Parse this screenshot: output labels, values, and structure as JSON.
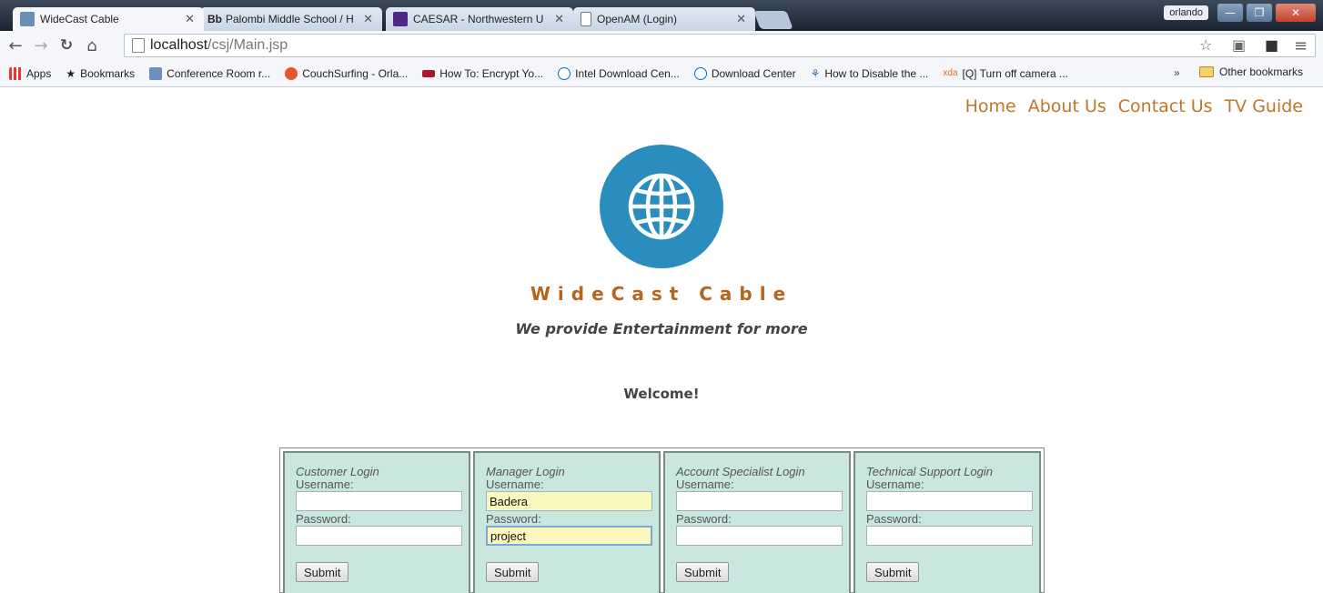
{
  "browser": {
    "tabs": [
      {
        "title": "WideCast Cable",
        "active": true
      },
      {
        "title": "Palombi Middle School / H",
        "prefix": "Bb"
      },
      {
        "title": "CAESAR - Northwestern U"
      },
      {
        "title": "OpenAM (Login)"
      }
    ],
    "user": "orlando",
    "url_host": "localhost",
    "url_path": "/csj/Main.jsp",
    "bookmarks": [
      "Apps",
      "Bookmarks",
      "Conference Room r...",
      "CouchSurfing - Orla...",
      "How To: Encrypt Yo...",
      "Intel Download Cen...",
      "Download Center",
      "How to Disable the ...",
      "[Q] Turn off camera ..."
    ],
    "more": "»",
    "other_bookmarks": "Other bookmarks"
  },
  "nav": {
    "home": "Home",
    "about": "About Us",
    "contact": "Contact Us",
    "tv_guide": "TV Guide"
  },
  "brand": "WideCast Cable",
  "tagline": "We provide Entertainment for more",
  "welcome": "Welcome!",
  "logins": [
    {
      "title": "Customer Login",
      "username_label": "Username:",
      "password_label": "Password:",
      "username": "",
      "password": "",
      "submit": "Submit"
    },
    {
      "title": "Manager Login",
      "username_label": "Username:",
      "password_label": "Password:",
      "username": "Badera",
      "password": "project",
      "submit": "Submit"
    },
    {
      "title": "Account Specialist Login",
      "username_label": "Username:",
      "password_label": "Password:",
      "username": "",
      "password": "",
      "submit": "Submit"
    },
    {
      "title": "Technical Support Login",
      "username_label": "Username:",
      "password_label": "Password:",
      "username": "",
      "password": "",
      "submit": "Submit"
    }
  ],
  "colors": {
    "accent": "#c0762a",
    "brand": "#b5651d",
    "logo": "#2a8dbd",
    "panel": "#c9e6df"
  }
}
